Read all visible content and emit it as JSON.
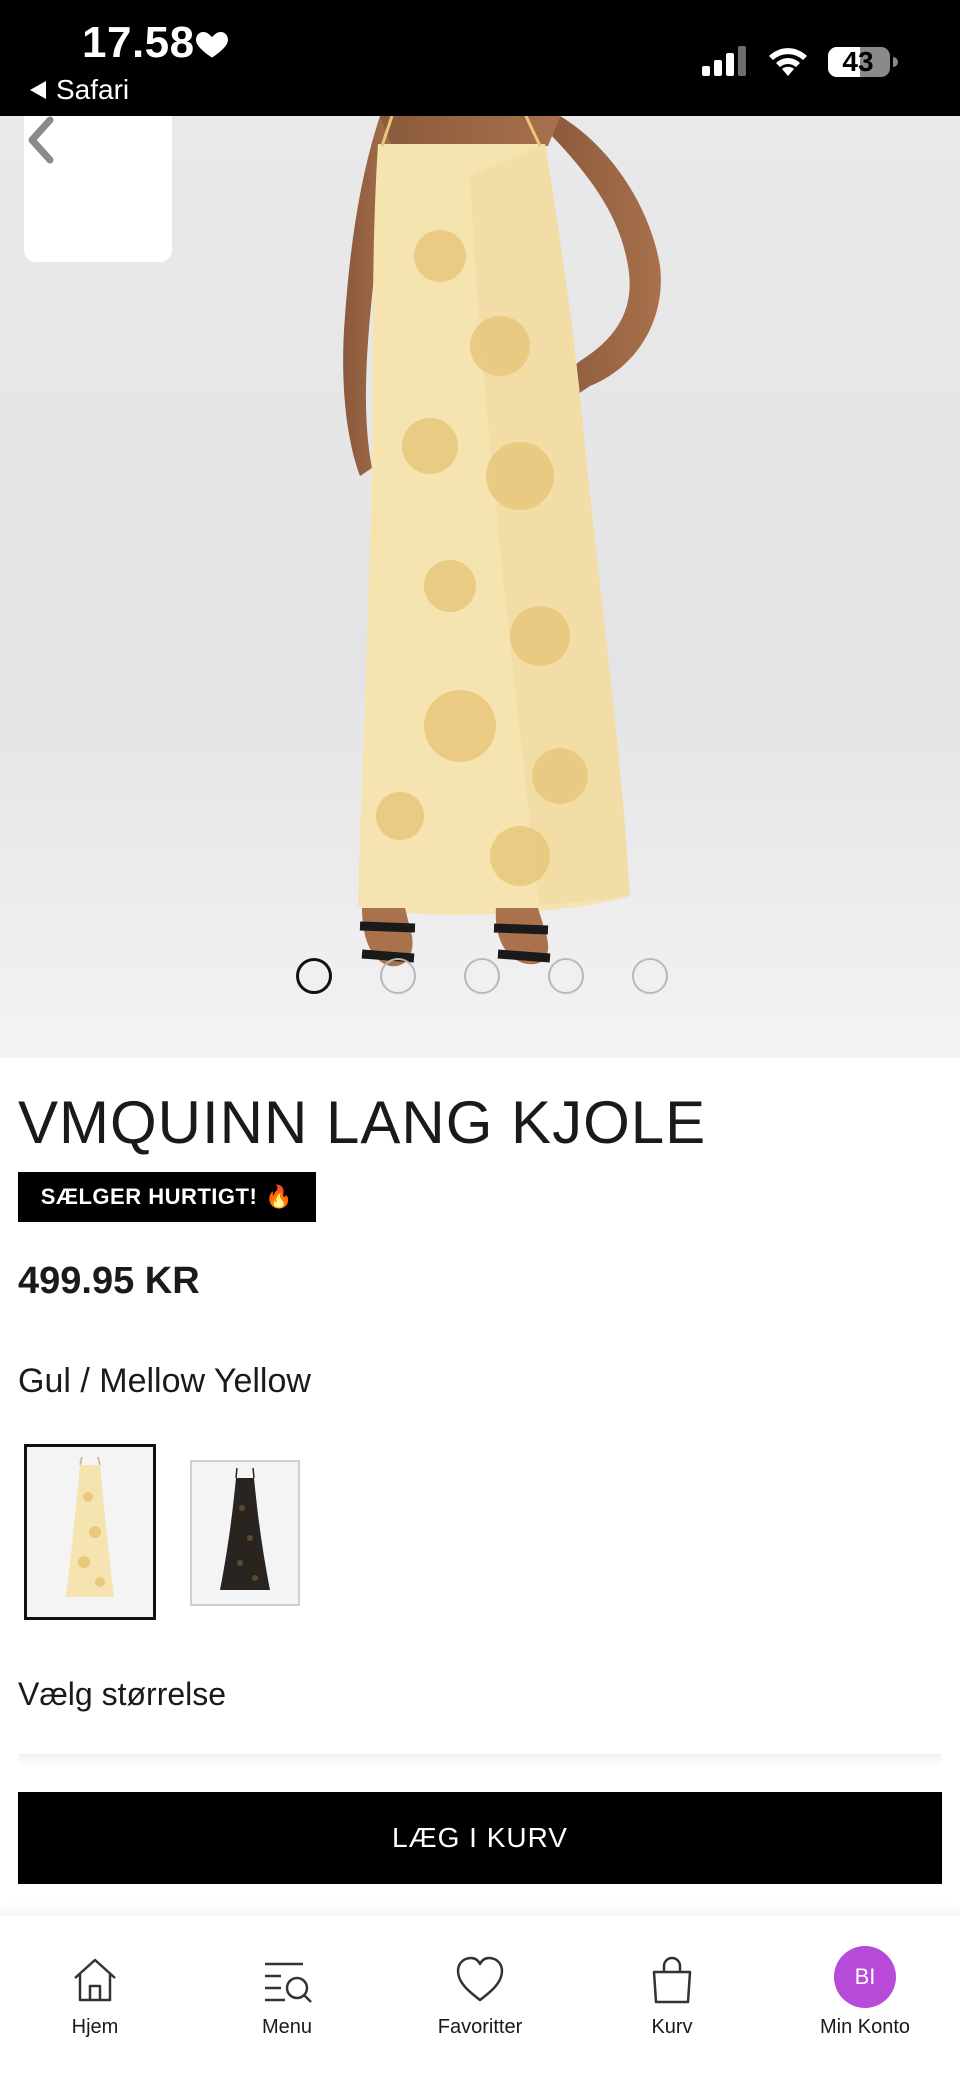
{
  "status_bar": {
    "time": "17.58",
    "back_app": "Safari",
    "battery": "43"
  },
  "gallery": {
    "image_count": 5,
    "active_index": 0
  },
  "product": {
    "title": "VMQUINN LANG KJOLE",
    "badge": "SÆLGER HURTIGT!",
    "badge_icon": "🔥",
    "price": "499.95 KR",
    "color_label": "Gul / Mellow Yellow",
    "size_prompt": "Vælg størrelse"
  },
  "actions": {
    "add_to_cart": "LÆG I KURV"
  },
  "bottom_nav": {
    "home": "Hjem",
    "menu": "Menu",
    "favorites": "Favoritter",
    "cart": "Kurv",
    "account": "Min Konto",
    "avatar_initials": "BI"
  },
  "colors": {
    "accent_avatar": "#b84ad9",
    "dress_yellow": "#f5e3b0",
    "primary_button": "#000000"
  }
}
